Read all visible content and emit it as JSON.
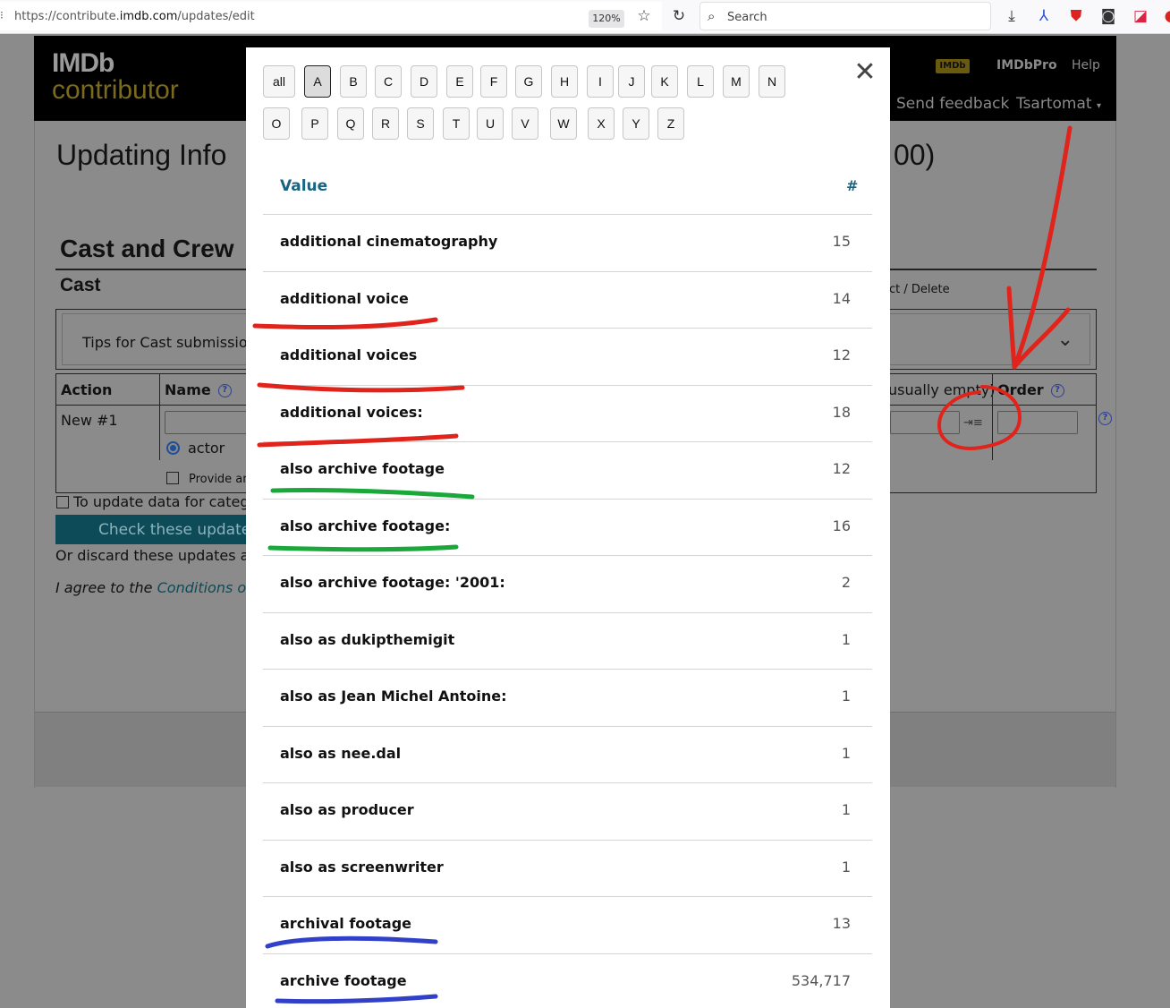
{
  "browser": {
    "url_prefix": "https://contribute.",
    "url_domain": "imdb.com",
    "url_path": "/updates/edit",
    "zoom": "120%",
    "search_placeholder": "Search"
  },
  "header": {
    "logo_top": "IMDb",
    "logo_bottom": "contributor",
    "imdb_badge": "IMDb",
    "imdbpro": "IMDbPro",
    "help": "Help",
    "send_feedback": "Send feedback",
    "user": "Tsartomat"
  },
  "page": {
    "title_start": "Updating Info",
    "title_end": "00)",
    "section": "Cast and Crew",
    "subsection": "Cast",
    "select_delete": "ct / Delete",
    "tips": "Tips for Cast submissions",
    "col_action": "Action",
    "col_name": "Name",
    "col_attr": "usually empty)",
    "col_order": "Order",
    "new_row": "New #1",
    "radio_actor": "actor",
    "provide": "Provide an",
    "to_update": "To update data for catego",
    "check_btn": "Check these update",
    "discard": "Or discard these updates and",
    "agree_prefix": "I agree to the ",
    "agree_link": "Conditions of U"
  },
  "modal": {
    "letters_row1": [
      "all",
      "A",
      "B",
      "C",
      "D",
      "E",
      "F",
      "G",
      "H",
      "I",
      "J",
      "K",
      "L",
      "M",
      "N"
    ],
    "letters_row2": [
      "O",
      "P",
      "Q",
      "R",
      "S",
      "T",
      "U",
      "V",
      "W",
      "X",
      "Y",
      "Z"
    ],
    "active_letter": "A",
    "col_value": "Value",
    "col_count": "#",
    "rows": [
      {
        "value": "additional cinematography",
        "count": "15"
      },
      {
        "value": "additional voice",
        "count": "14"
      },
      {
        "value": "additional voices",
        "count": "12"
      },
      {
        "value": "additional voices:",
        "count": "18"
      },
      {
        "value": "also archive footage",
        "count": "12"
      },
      {
        "value": "also archive footage:",
        "count": "16"
      },
      {
        "value": "also archive footage: '2001:",
        "count": "2"
      },
      {
        "value": "also as dukipthemigit",
        "count": "1"
      },
      {
        "value": "also as Jean Michel Antoine:",
        "count": "1"
      },
      {
        "value": "also as nee.dal",
        "count": "1"
      },
      {
        "value": "also as producer",
        "count": "1"
      },
      {
        "value": "also as screenwriter",
        "count": "1"
      },
      {
        "value": "archival footage",
        "count": "13"
      },
      {
        "value": "archive footage",
        "count": "534,717"
      }
    ]
  },
  "colors": {
    "annotation_red": "#e0241c",
    "annotation_green": "#1aa83a",
    "annotation_blue": "#3040c8",
    "teal_link": "#1a6480"
  }
}
